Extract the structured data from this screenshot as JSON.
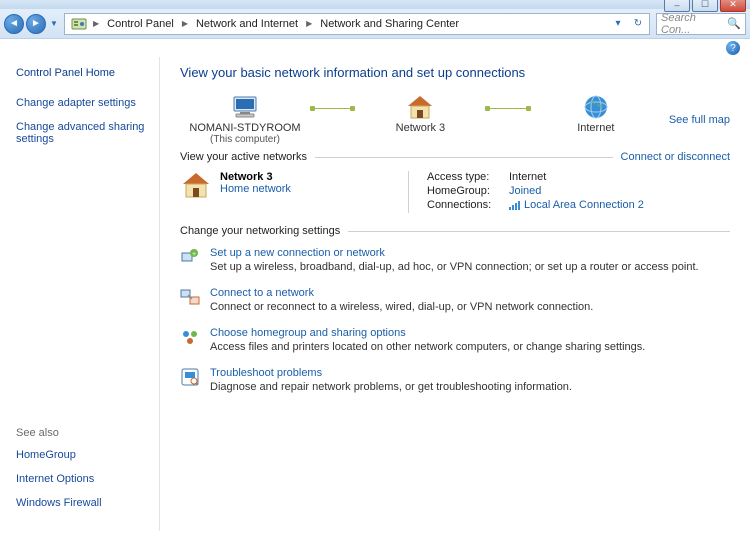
{
  "window": {
    "min": "–",
    "max": "☐",
    "close": "✕"
  },
  "breadcrumbs": {
    "a": "Control Panel",
    "b": "Network and Internet",
    "c": "Network and Sharing Center"
  },
  "search": {
    "placeholder": "Search Con..."
  },
  "sidebar": {
    "home": "Control Panel Home",
    "links": {
      "adapter": "Change adapter settings",
      "advanced": "Change advanced sharing settings"
    },
    "see_also_label": "See also",
    "see_also": {
      "homegroup": "HomeGroup",
      "inet": "Internet Options",
      "fw": "Windows Firewall"
    }
  },
  "page_title": "View your basic network information and set up connections",
  "full_map": "See full map",
  "nodes": {
    "pc_name": "NOMANI-STDYROOM",
    "pc_sub": "(This computer)",
    "net_name": "Network  3",
    "internet": "Internet"
  },
  "active_hdr": "View your active networks",
  "connect_link": "Connect or disconnect",
  "active": {
    "name": "Network  3",
    "type": "Home network",
    "kv": {
      "access_k": "Access type:",
      "access_v": "Internet",
      "hg_k": "HomeGroup:",
      "hg_v": "Joined",
      "conn_k": "Connections:",
      "conn_v": "Local Area Connection 2"
    }
  },
  "tasks_hdr": "Change your networking settings",
  "tasks": {
    "t1": {
      "title": "Set up a new connection or network",
      "desc": "Set up a wireless, broadband, dial-up, ad hoc, or VPN connection; or set up a router or access point."
    },
    "t2": {
      "title": "Connect to a network",
      "desc": "Connect or reconnect to a wireless, wired, dial-up, or VPN network connection."
    },
    "t3": {
      "title": "Choose homegroup and sharing options",
      "desc": "Access files and printers located on other network computers, or change sharing settings."
    },
    "t4": {
      "title": "Troubleshoot problems",
      "desc": "Diagnose and repair network problems, or get troubleshooting information."
    }
  }
}
